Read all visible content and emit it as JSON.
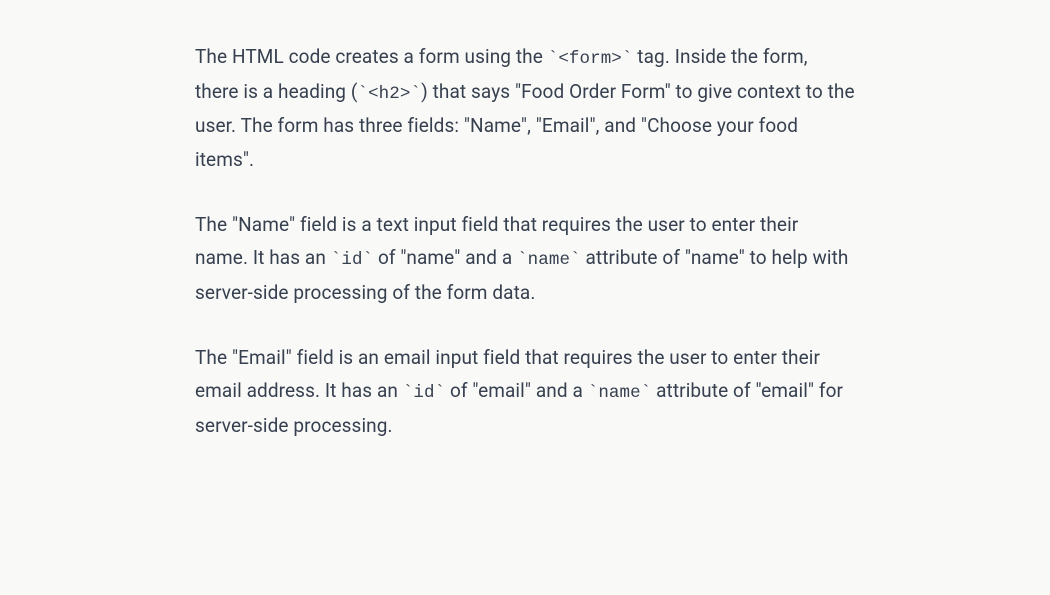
{
  "paragraphs": {
    "p1": {
      "t1": "The HTML code creates a form using the ",
      "c1": "`<form>`",
      "t2": " tag. Inside the form, there is a heading (",
      "c2": "`<h2>`",
      "t3": ") that says \"Food Order Form\" to give context to the user. The form has three fields: \"Name\", \"Email\", and \"Choose your food items\"."
    },
    "p2": {
      "t1": "The \"Name\" field is a text input field that requires the user to enter their name. It has an ",
      "c1": "`id`",
      "t2": " of \"name\" and a ",
      "c2": "`name`",
      "t3": " attribute of \"name\" to help with server-side processing of the form data."
    },
    "p3": {
      "t1": "The \"Email\" field is an email input field that requires the user to enter their email address. It has an ",
      "c1": "`id`",
      "t2": " of \"email\" and a ",
      "c2": "`name`",
      "t3": " attribute of \"email\" for server-side processing."
    }
  }
}
